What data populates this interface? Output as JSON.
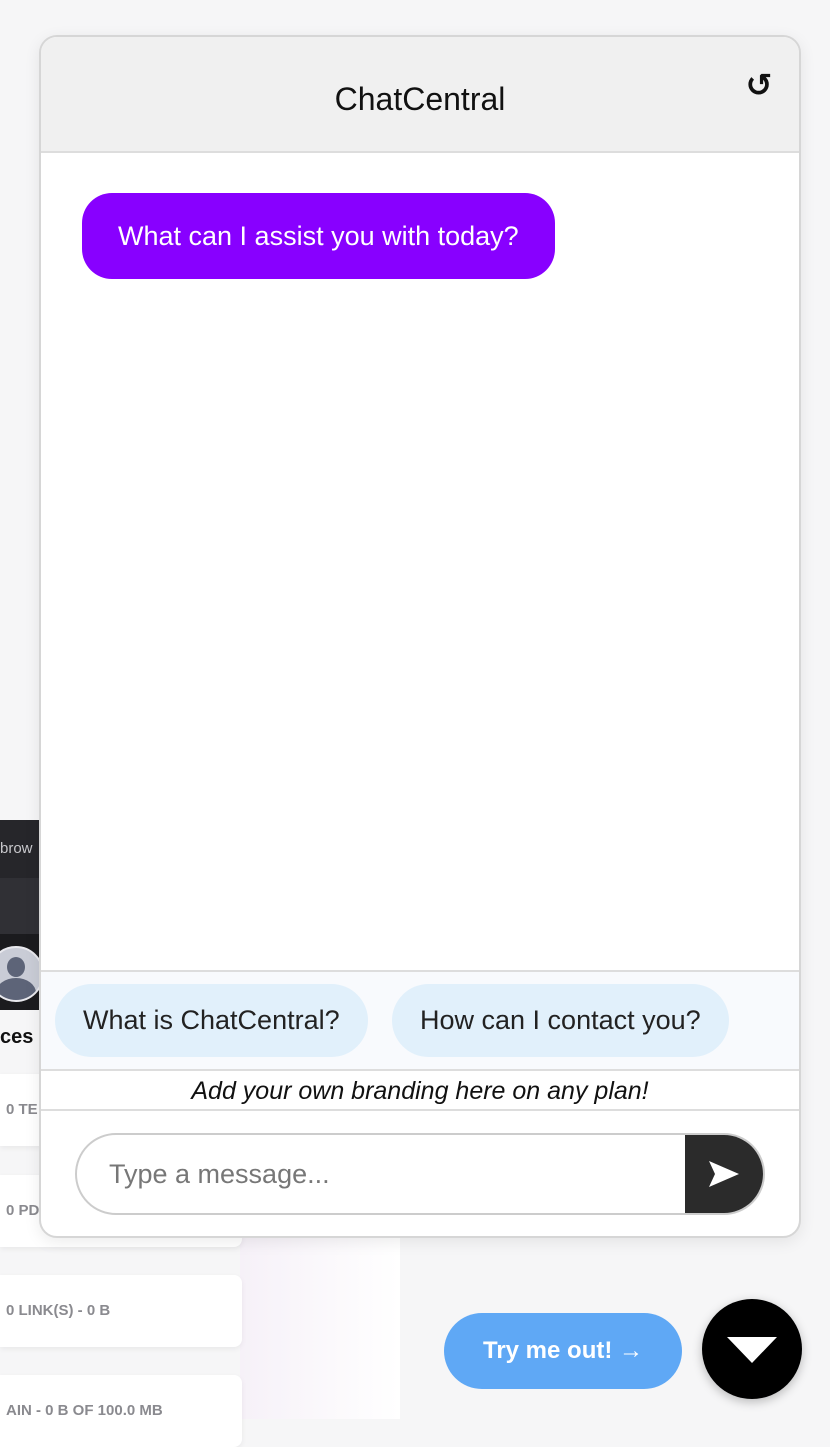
{
  "background": {
    "bar_text": "brow",
    "section_label_fragment": "ces",
    "cards": [
      "0 TE",
      "0 PD",
      "0 LINK(S) - 0 B",
      "AIN - 0 B OF 100.0 MB"
    ]
  },
  "chat": {
    "title": "ChatCentral",
    "reset_icon": "refresh-icon",
    "messages": [
      {
        "sender": "bot",
        "text": "What can I assist you with today?"
      }
    ],
    "suggestions": [
      "What is ChatCentral?",
      "How can I contact you?"
    ],
    "branding": "Add your own branding here on any plan!",
    "input": {
      "placeholder": "Type a message...",
      "value": ""
    },
    "send_icon": "send-arrow-icon"
  },
  "launcher": {
    "cta_label": "Try me out! →",
    "toggle_icon": "chevron-down-icon"
  },
  "colors": {
    "bot_bubble": "#8800ff",
    "suggestion_chip": "#e1f0fb",
    "cta_button": "#5fa8f5",
    "send_button": "#2b2b2b"
  }
}
